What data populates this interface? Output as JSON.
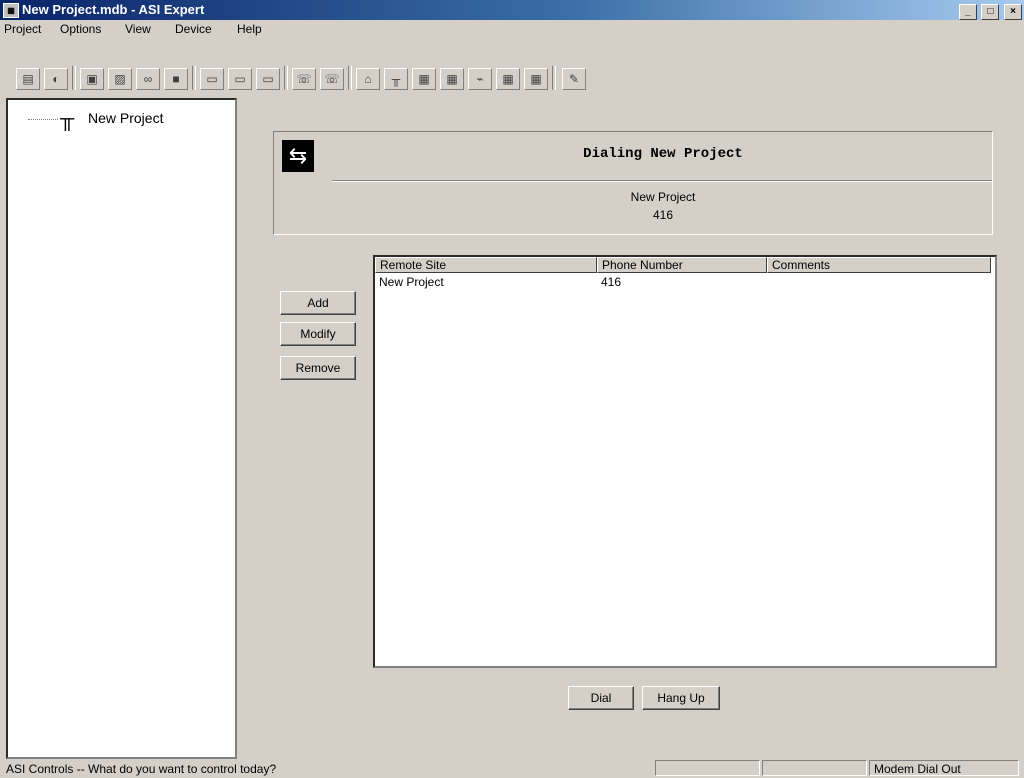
{
  "window": {
    "title": "New Project.mdb - ASI Expert",
    "minimize": "_",
    "maximize": "□",
    "close": "×"
  },
  "menubar": {
    "items": [
      {
        "label": "Project"
      },
      {
        "label": "Options"
      },
      {
        "label": "View"
      },
      {
        "label": "Device"
      },
      {
        "label": "Help"
      }
    ]
  },
  "toolbar": {
    "buttons": [
      {
        "icon": "print-icon"
      },
      {
        "icon": "globe-icon"
      },
      {
        "icon": "clipboard-icon"
      },
      {
        "icon": "image-icon"
      },
      {
        "icon": "binoculars-icon"
      },
      {
        "icon": "book-icon"
      },
      {
        "icon": "save-icon"
      },
      {
        "icon": "save-all-icon"
      },
      {
        "icon": "export-icon"
      },
      {
        "icon": "connect-icon"
      },
      {
        "icon": "disconnect-icon"
      },
      {
        "icon": "home-icon"
      },
      {
        "icon": "tree-icon"
      },
      {
        "icon": "list-icon"
      },
      {
        "icon": "table-icon"
      },
      {
        "icon": "chart-icon"
      },
      {
        "icon": "grid-icon"
      },
      {
        "icon": "monitor-icon"
      },
      {
        "icon": "edit-icon"
      }
    ]
  },
  "tree": {
    "root_label": "New Project"
  },
  "dial": {
    "title": "Dialing New Project",
    "site": "New Project",
    "phone": "416"
  },
  "buttons": {
    "add": "Add",
    "modify": "Modify",
    "remove": "Remove",
    "dial": "Dial",
    "hang_up": "Hang Up"
  },
  "table": {
    "columns": [
      "Remote Site",
      "Phone Number",
      "Comments"
    ],
    "rows": [
      {
        "remote_site": "New Project",
        "phone_number": "416",
        "comments": ""
      }
    ]
  },
  "status": {
    "message": "ASI Controls -- What do you want to control today?",
    "panel3": "Modem Dial Out"
  }
}
